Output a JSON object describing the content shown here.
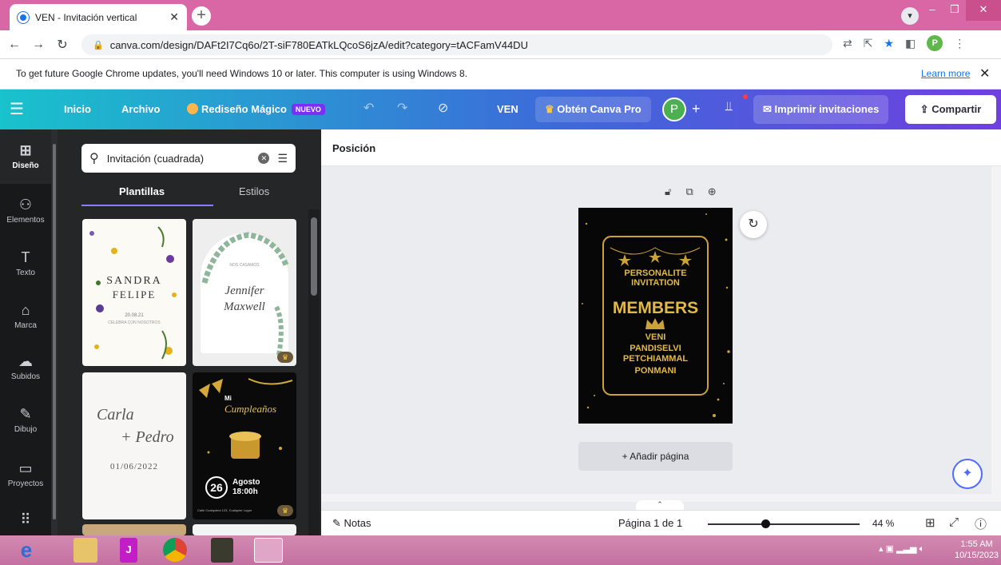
{
  "browser": {
    "tab_title": "VEN - Invitación vertical",
    "url": "canva.com/design/DAFt2I7Cq6o/2T-siF780EATkLQcoS6jzA/edit?category=tACFamV44DU",
    "profile_initial": "P",
    "infobar": {
      "message": "To get future Google Chrome updates, you'll need Windows 10 or later. This computer is using Windows 8.",
      "learn_more": "Learn more"
    }
  },
  "toolbar": {
    "home": "Inicio",
    "file": "Archivo",
    "magic": "Rediseño Mágico",
    "new_badge": "NUEVO",
    "design_name": "VEN",
    "get_pro": "Obtén Canva Pro",
    "avatar_initial": "P",
    "print": "Imprimir invitaciones",
    "share": "Compartir",
    "accent_gradient": [
      "#19c2cc",
      "#6f3fe0"
    ]
  },
  "rail": {
    "items": [
      {
        "label": "Diseño",
        "icon": "layout-icon"
      },
      {
        "label": "Elementos",
        "icon": "shapes-icon"
      },
      {
        "label": "Texto",
        "icon": "text-icon"
      },
      {
        "label": "Marca",
        "icon": "brand-icon"
      },
      {
        "label": "Subidos",
        "icon": "upload-cloud-icon"
      },
      {
        "label": "Dibujo",
        "icon": "draw-icon"
      },
      {
        "label": "Proyectos",
        "icon": "folder-icon"
      }
    ]
  },
  "panel": {
    "search_value": "Invitación (cuadrada)",
    "tabs": [
      "Plantillas",
      "Estilos"
    ],
    "templates": [
      {
        "line1": "SANDRA",
        "line2": "FELIPE",
        "date": "20.08.21",
        "caption": "CELEBRA CON NOSOTROS"
      },
      {
        "line1": "Jennifer",
        "line2": "Maxwell",
        "caption": "NOS CASAMOS",
        "pro": true
      },
      {
        "line1": "Carla",
        "line2": "+ Pedro",
        "date": "01/06/2022"
      },
      {
        "line1": "Mi",
        "line2": "Cumpleaños",
        "day": "26",
        "month": "Agosto",
        "time": "18:00h",
        "footer": "Calle Cualquiera 123, Cualquier Lugar",
        "pro": true
      }
    ]
  },
  "workspace": {
    "position_label": "Posición",
    "design": {
      "line1": "PERSONALITE",
      "line2": "INVITATION",
      "heading": "MEMBERS",
      "names": [
        "VENI",
        "PANDISELVI",
        "PETCHIAMMAL",
        "PONMANI"
      ]
    },
    "add_page": "+ Añadir página"
  },
  "footer": {
    "notes": "Notas",
    "page": "Página 1 de 1",
    "zoom": "44 %",
    "zoom_level": 0.44
  },
  "taskbar": {
    "time": "1:55 AM",
    "date": "10/15/2023"
  }
}
